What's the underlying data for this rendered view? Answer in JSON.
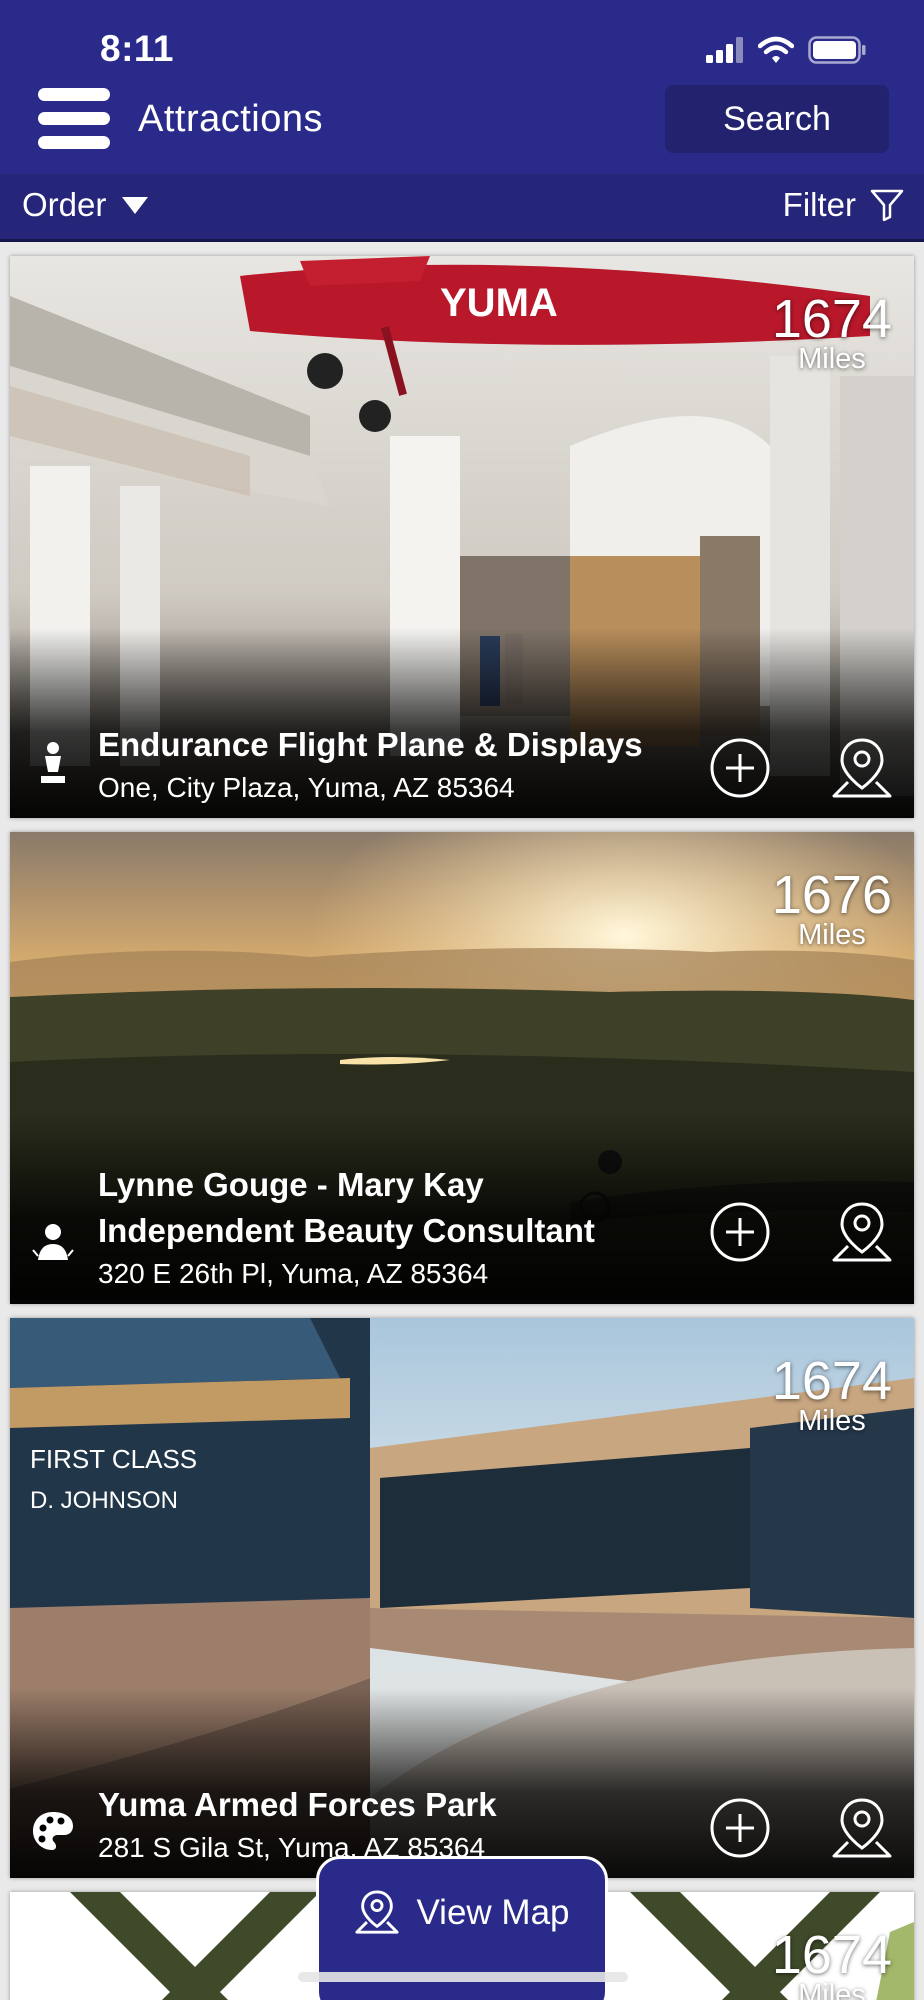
{
  "status_bar": {
    "time": "8:11"
  },
  "header": {
    "title": "Attractions",
    "search_label": "Search"
  },
  "toolbar": {
    "order_label": "Order",
    "filter_label": "Filter"
  },
  "attractions": [
    {
      "name": "Endurance Flight Plane & Displays",
      "address": "One, City Plaza, Yuma, AZ 85364",
      "distance": "1674",
      "distance_unit": "Miles",
      "category_icon": "statue-icon"
    },
    {
      "name": "Lynne Gouge - Mary Kay Independent Beauty Consultant",
      "address": "320 E 26th Pl, Yuma, AZ 85364",
      "distance": "1676",
      "distance_unit": "Miles",
      "category_icon": "person-icon"
    },
    {
      "name": "Yuma Armed Forces Park",
      "address": "281 S Gila St, Yuma, AZ 85364",
      "distance": "1674",
      "distance_unit": "Miles",
      "category_icon": "palette-icon"
    },
    {
      "distance": "1674",
      "distance_unit": "Miles"
    }
  ],
  "view_map": {
    "label": "View Map"
  },
  "colors": {
    "brand": "#2a2a8a",
    "toolbar": "#25257a",
    "search_bg": "#22226f"
  }
}
